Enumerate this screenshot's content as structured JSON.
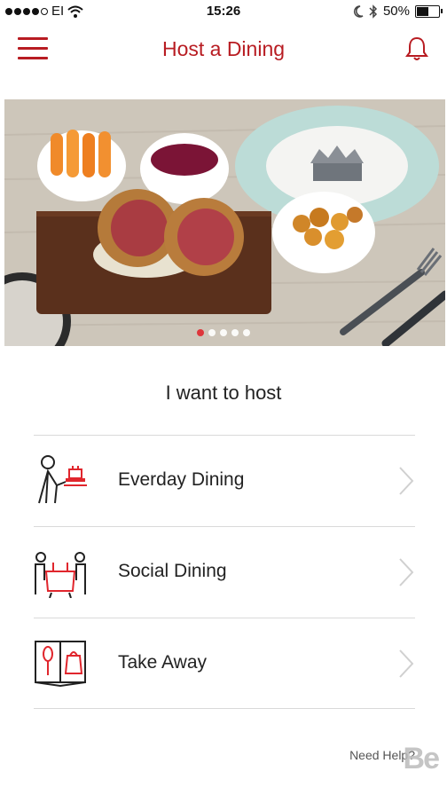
{
  "status_bar": {
    "carrier": "EI",
    "time": "15:26",
    "battery": "50%"
  },
  "header": {
    "title": "Host a Dining"
  },
  "hero": {
    "slide_count": 5,
    "active_slide": 1
  },
  "main": {
    "heading": "I want to host",
    "options": [
      {
        "label": "Everday Dining",
        "icon": "waiter-serving-icon"
      },
      {
        "label": "Social Dining",
        "icon": "people-at-table-icon"
      },
      {
        "label": "Take Away",
        "icon": "menu-book-takeaway-icon"
      }
    ]
  },
  "footer": {
    "help": "Need Help?",
    "watermark": "Be"
  },
  "colors": {
    "accent": "#b81c22",
    "active_dot": "#e0262d",
    "divider": "#d9d9d9"
  }
}
